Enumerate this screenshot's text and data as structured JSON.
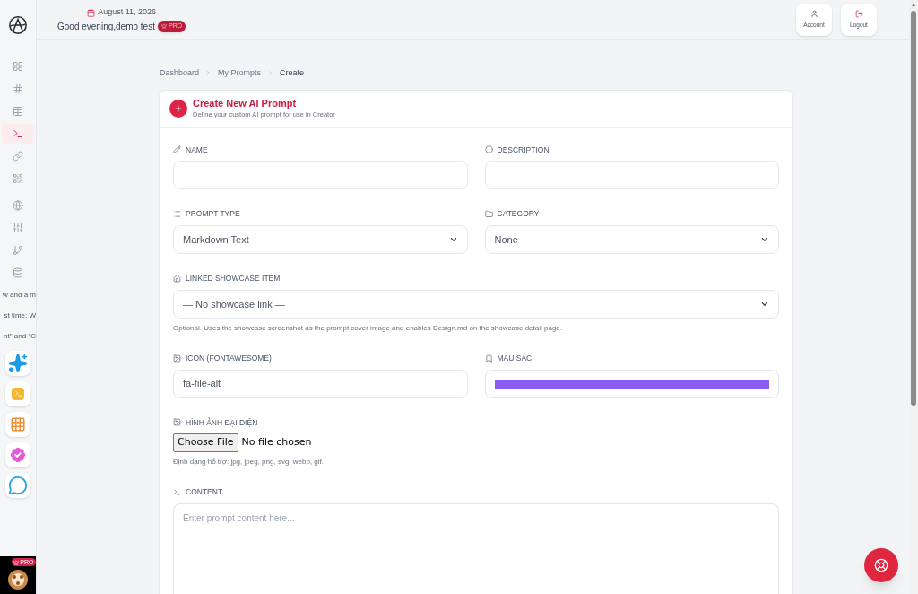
{
  "header": {
    "date": "August 11, 2026",
    "greeting": "Good evening,demo test",
    "badge": "PRO",
    "actions": [
      {
        "kind": "account",
        "label": "Account"
      },
      {
        "kind": "logout",
        "label": "Logout"
      }
    ]
  },
  "sidebar": {
    "items": [
      {
        "kind": "grid",
        "selected": false
      },
      {
        "kind": "hash",
        "selected": false
      },
      {
        "kind": "table",
        "selected": false
      },
      {
        "kind": "terminal",
        "selected": true
      },
      {
        "kind": "link",
        "selected": false
      },
      {
        "kind": "qr",
        "selected": false
      },
      {
        "kind": "globe",
        "selected": false
      },
      {
        "kind": "sliders",
        "selected": false
      },
      {
        "kind": "branch",
        "selected": false
      },
      {
        "kind": "database",
        "selected": false
      }
    ],
    "snippets": [
      "w and a m",
      "st time: W",
      "nt\" and \"C"
    ],
    "apps": [
      {
        "kind": "sparkles"
      },
      {
        "kind": "terminal"
      },
      {
        "kind": "grid"
      },
      {
        "kind": "badge"
      },
      {
        "kind": "chat"
      }
    ],
    "user_badge": "PRO"
  },
  "breadcrumb": [
    "Dashboard",
    "My Prompts",
    "Create"
  ],
  "form": {
    "title": "Create New AI Prompt",
    "subtitle": "Define your custom AI prompt for use in Creator",
    "rows": [
      [
        {
          "kind": "text",
          "label": "NAME"
        },
        {
          "kind": "text",
          "label": "DESCRIPTION"
        }
      ],
      [
        {
          "kind": "select",
          "label": "PROMPT TYPE",
          "value": "Markdown Text"
        },
        {
          "kind": "select",
          "label": "CATEGORY",
          "value": "None"
        }
      ],
      [
        {
          "kind": "select",
          "label": "LINKED SHOWCASE ITEM",
          "value": "— No showcase link —",
          "help": "Optional. Uses the showcase screenshot as the prompt cover image and enables Design.md on the showcase detail page."
        }
      ],
      [
        {
          "kind": "text",
          "label": "ICON (FONTAWESOME)",
          "value": "fa-file-alt"
        },
        {
          "kind": "color",
          "label": "MÀU SẮC",
          "color": "#8b5cf6"
        }
      ],
      [
        {
          "kind": "file",
          "label": "HÌNH ẢNH ĐẠI DIỆN",
          "button": "Choose File",
          "status": "No file chosen",
          "help": "Định dạng hỗ trợ: jpg, jpeg, png, svg, webp, gif."
        }
      ],
      [
        {
          "kind": "textarea",
          "label": "CONTENT",
          "placeholder": "Enter prompt content here..."
        }
      ]
    ]
  }
}
